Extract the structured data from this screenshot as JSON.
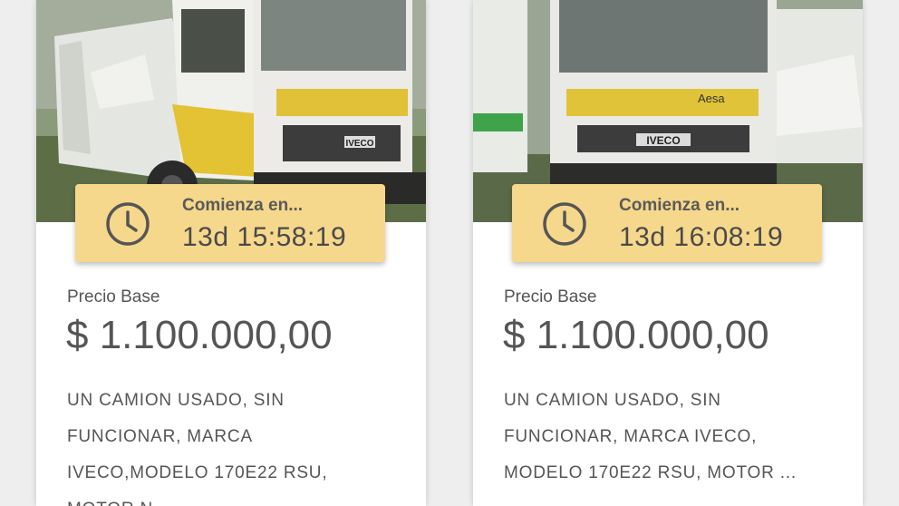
{
  "listings": [
    {
      "photo_name": "iveco-garbage-truck-side",
      "timer_label": "Comienza en...",
      "timer_value": "13d 15:58:19",
      "price_label": "Precio Base",
      "price_value": "$ 1.100.000,00",
      "desc_lines": [
        "UN CAMION USADO, SIN",
        "FUNCIONAR, MARCA",
        "IVECO,MODELO 170E22 RSU,",
        "MOTOR N..."
      ]
    },
    {
      "photo_name": "iveco-garbage-truck-front",
      "timer_label": "Comienza en...",
      "timer_value": "13d 16:08:19",
      "price_label": "Precio Base",
      "price_value": "$ 1.100.000,00",
      "desc_lines": [
        "UN CAMION USADO, SIN",
        "FUNCIONAR, MARCA IVECO,",
        "MODELO 170E22 RSU, MOTOR ..."
      ]
    }
  ],
  "truck_text": {
    "brand": "IVECO",
    "operator": "Aesa"
  },
  "colors": {
    "timer_bg": "#f6d88c",
    "text": "#555555",
    "card_bg": "#ffffff"
  },
  "icons": {
    "timer_icon": "clock-icon"
  }
}
